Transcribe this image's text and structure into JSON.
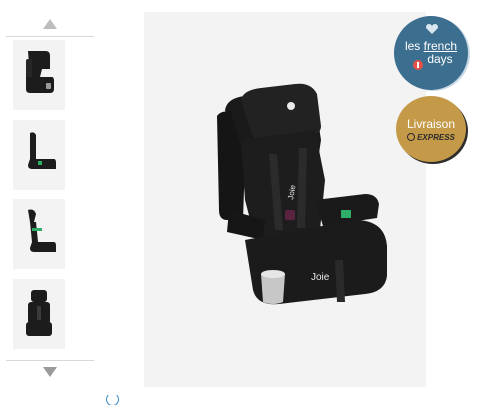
{
  "gallery": {
    "thumbnails": [
      {
        "view": "front-three-quarter",
        "selected": true
      },
      {
        "view": "side-profile"
      },
      {
        "view": "side-reclined"
      },
      {
        "view": "front"
      }
    ],
    "nav_up_icon": "triangle-up-icon",
    "nav_down_icon": "triangle-down-icon"
  },
  "product_image": {
    "brand_text": "Joie",
    "colors": {
      "seat": "#1b1b1b",
      "accent": "#2fae6a",
      "background": "#f3f3f3"
    }
  },
  "badges": {
    "french_days": {
      "line1_a": "les ",
      "line1_b": "french",
      "line2": "days",
      "color": "#3c6e8f"
    },
    "livraison": {
      "line1": "Livraison",
      "line2": "EXPRESS",
      "color": "#c49a48"
    }
  },
  "loading": {
    "icon": "spinner-icon",
    "color": "#3a8bc7"
  }
}
